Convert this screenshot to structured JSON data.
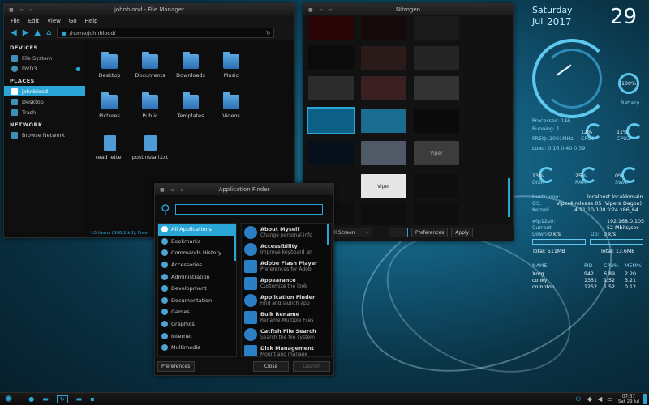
{
  "file_manager": {
    "title": "johnblood - File Manager",
    "menu": [
      "File",
      "Edit",
      "View",
      "Go",
      "Help"
    ],
    "path": "/home/johnblood/",
    "sections": [
      {
        "title": "DEVICES",
        "items": [
          {
            "label": "File System",
            "icon": "harddisk-icon"
          },
          {
            "label": "DVD3",
            "icon": "disc-icon"
          }
        ]
      },
      {
        "title": "PLACES",
        "items": [
          {
            "label": "johnblood",
            "icon": "home-icon"
          },
          {
            "label": "Desktop",
            "icon": "desktop-icon"
          },
          {
            "label": "Trash",
            "icon": "trash-icon"
          }
        ]
      },
      {
        "title": "NETWORK",
        "items": [
          {
            "label": "Browse Network",
            "icon": "network-icon"
          }
        ]
      }
    ],
    "files": [
      "Desktop",
      "Documents",
      "Downloads",
      "Music",
      "Pictures",
      "Public",
      "Templates",
      "Videos",
      "read letter",
      "postinstall.txt"
    ],
    "status": "10 items (688.1 kB), Free"
  },
  "nitrogen": {
    "title": "Nitrogen",
    "mode": "Full Screen",
    "prefs": "Preferences",
    "apply": "Apply",
    "thumb_labels": [
      "Viper",
      "Viper"
    ]
  },
  "finder": {
    "title": "Application Finder",
    "categories": [
      "All Applications",
      "Bookmarks",
      "Commands History",
      "Accessories",
      "Administration",
      "Development",
      "Documentation",
      "Games",
      "Graphics",
      "Internet",
      "Multimedia"
    ],
    "apps": [
      {
        "name": "About Myself",
        "desc": "Change personal info"
      },
      {
        "name": "Accessibility",
        "desc": "Improve keyboard an"
      },
      {
        "name": "Adobe Flash Player",
        "desc": "Preferences for Adob"
      },
      {
        "name": "Appearance",
        "desc": "Customize the look"
      },
      {
        "name": "Application Finder",
        "desc": "Find and launch app"
      },
      {
        "name": "Bulk Rename",
        "desc": "Rename Multiple Files"
      },
      {
        "name": "Catfish File Search",
        "desc": "Search the file system"
      },
      {
        "name": "Disk Management",
        "desc": "Mount and manage"
      }
    ],
    "preferences": "Preferences",
    "close": "Close",
    "launch": "Launch"
  },
  "conky": {
    "day": "Saturday",
    "month": "Jul",
    "year": "2017",
    "date": "29",
    "battery_pct": "100%",
    "battery_label": "Battery",
    "processes": "Processes: 146",
    "running": "Running: 1",
    "freq": "FREQ: 2001MHz",
    "load": "Load: 0.16 0.40 0.39",
    "cpu1": "12%",
    "cpu1_label": "CPU1",
    "cpu2": "11%",
    "cpu2_label": "CPU2",
    "disk": "13%",
    "disk_label": "DISK",
    "ram": "25%",
    "ram_label": "RAM",
    "swap": "0%",
    "swap_label": "SWAP",
    "hostname_k": "Hostname:",
    "hostname_v": "localhost.localdomain",
    "os_k": "OS:",
    "os_v": "Viper4 release 05 (Vipera Dagon)",
    "kernel_k": "Kernel:",
    "kernel_v": "4.11.10-100.fc24.x86_64",
    "net_if": "wlp12s0:",
    "ip": "192.168.0.105",
    "current_k": "Current:",
    "current_v": "52 Mbits/sec",
    "down_k": "Down:",
    "down_v": "0 k/s",
    "up_k": "Up:",
    "up_v": "0 k/s",
    "total_down": "Total: 511MB",
    "total_up": "Total: 13.6MB",
    "table_head": [
      "NAME",
      "PID",
      "CPU%",
      "MEM%"
    ],
    "procs": [
      [
        "Xorg",
        "942",
        "6.89",
        "2.20"
      ],
      [
        "conky",
        "1351",
        "1.52",
        "3.21"
      ],
      [
        "compton",
        "1252",
        "1.52",
        "0.12"
      ]
    ]
  },
  "panel": {
    "clock": "07:37",
    "date": "Sat 29 Jul"
  }
}
